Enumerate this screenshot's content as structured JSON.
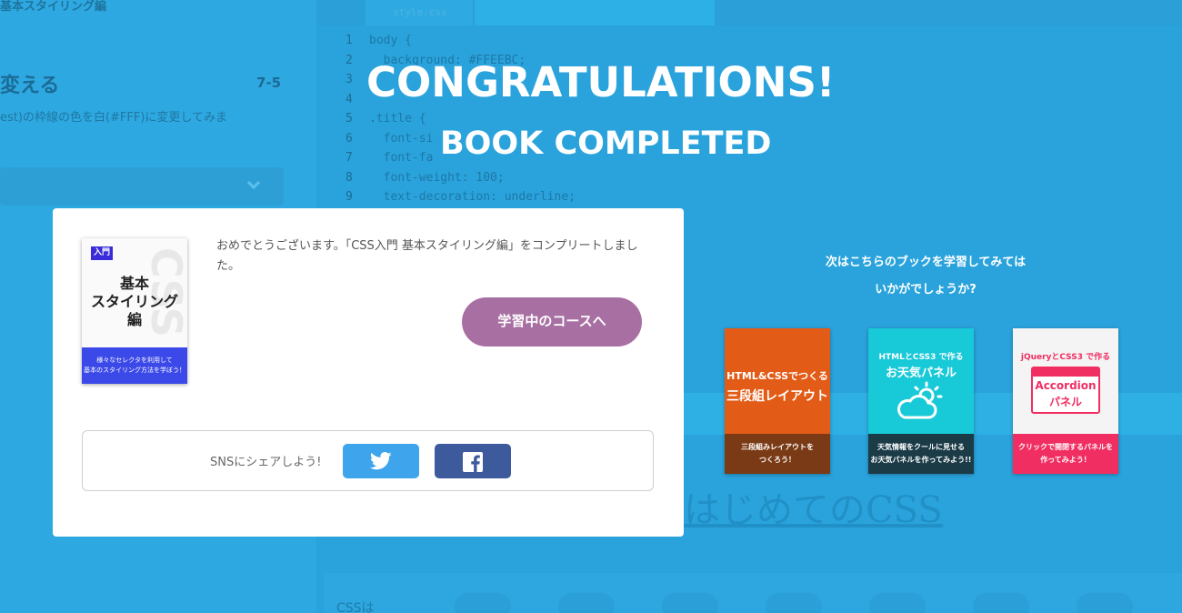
{
  "background": {
    "sidebar_title": "基本スタイリング編",
    "lesson_heading": "変える",
    "lesson_number": "7-5",
    "lesson_desc": "est)の枠線の色を白(#FFF)に変更してみま",
    "editor_tab": "style.css",
    "code_lines": [
      {
        "n": "1",
        "t": "body {"
      },
      {
        "n": "2",
        "t": "  background: #FFEEBC;"
      },
      {
        "n": "3",
        "t": ""
      },
      {
        "n": "4",
        "t": ""
      },
      {
        "n": "5",
        "t": ".title {"
      },
      {
        "n": "6",
        "t": "  font-si"
      },
      {
        "n": "7",
        "t": "  font-fa"
      },
      {
        "n": "8",
        "t": "  font-weight: 100;"
      },
      {
        "n": "9",
        "t": "  text-decoration: underline;"
      }
    ],
    "preview_big_text": "はじめてのCSS",
    "bottom_text": "CSSは"
  },
  "overlay": {
    "headline": "CONGRATULATIONS!",
    "subheadline": "BOOK COMPLETED",
    "card": {
      "cover": {
        "badge": "入門",
        "watermark": "CSS",
        "title_line1": "基本",
        "title_line2": "スタイリング",
        "title_line3": "編",
        "strip_line1": "様々なセレクタを利用して",
        "strip_line2": "基本のスタイリング方法を学ぼう！"
      },
      "message": "おめでとうございます。「CSS入門 基本スタイリング編」をコンプリートしました。",
      "course_button": "学習中のコースへ",
      "share_label": "SNSにシェアしよう!"
    },
    "recommend_line1": "次はこちらのブックを学習してみては",
    "recommend_line2": "いかがでしょうか?",
    "books": [
      {
        "top_line1": "HTML&CSSでつくる",
        "top_line2": "三段組レイアウト",
        "bottom_line1": "三段組みレイアウトを",
        "bottom_line2": "つくろう！",
        "accent": "#e25c17"
      },
      {
        "top_line1": "HTMLとCSS3 で作る",
        "top_line2": "お天気パネル",
        "bottom_line1": "天気情報をクールに見せる",
        "bottom_line2": "お天気パネルを作ってみよう!!",
        "accent": "#18c9d8"
      },
      {
        "top_line1": "jQueryとCSS3 で作る",
        "top_line2": "Accordion",
        "top_line3": "パネル",
        "bottom_line1": "クリックで開閉するパネルを",
        "bottom_line2": "作ってみよう！",
        "accent": "#f02e62"
      }
    ]
  }
}
